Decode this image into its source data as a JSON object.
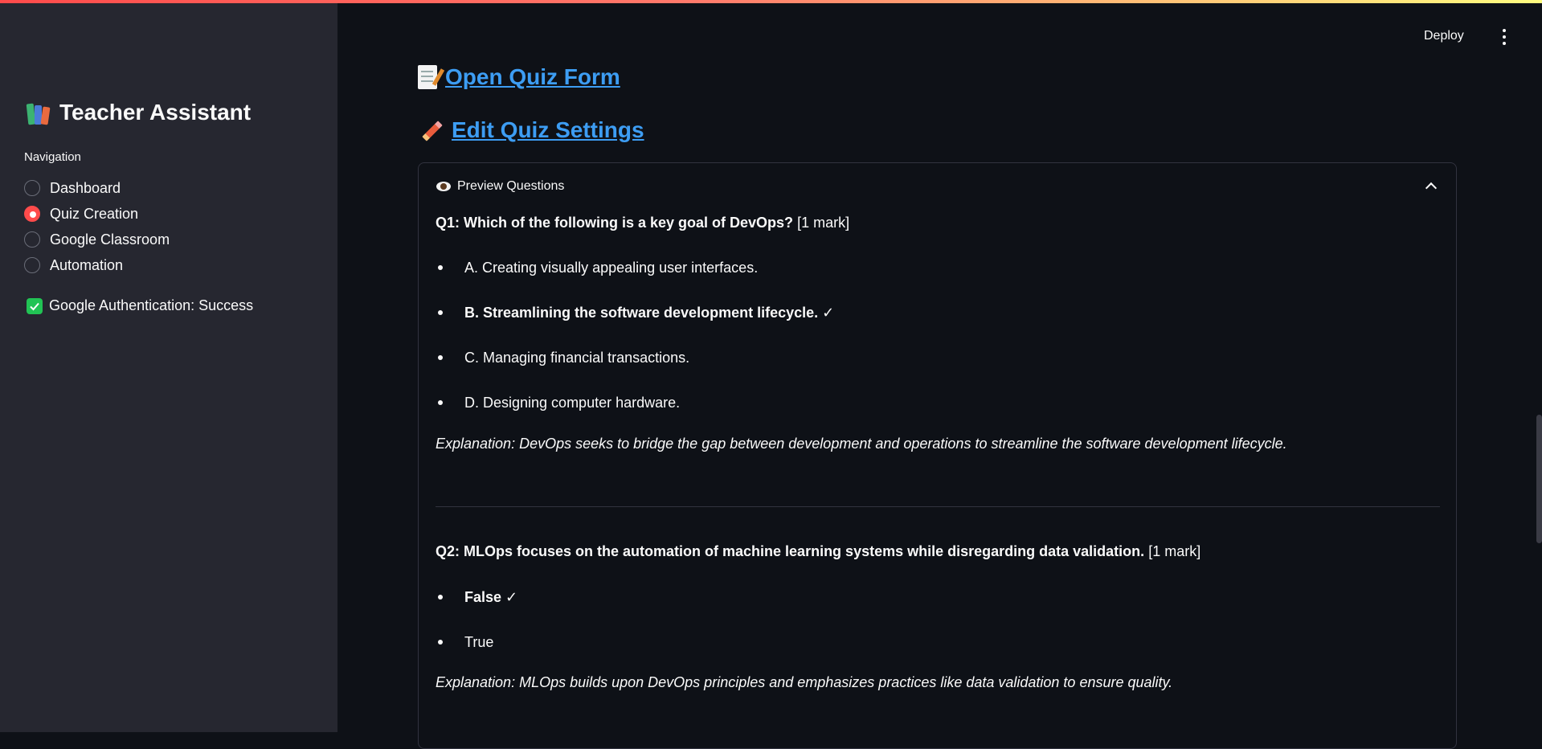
{
  "sidebar": {
    "title": "Teacher Assistant",
    "nav_label": "Navigation",
    "nav_items": [
      {
        "label": "Dashboard",
        "selected": false
      },
      {
        "label": "Quiz Creation",
        "selected": true
      },
      {
        "label": "Google Classroom",
        "selected": false
      },
      {
        "label": "Automation",
        "selected": false
      }
    ],
    "auth_status": "Google Authentication: Success"
  },
  "header": {
    "deploy_label": "Deploy"
  },
  "main": {
    "open_quiz_link": "Open Quiz Form",
    "edit_settings_link": "Edit Quiz Settings",
    "expander": {
      "title": "Preview Questions",
      "questions": [
        {
          "text": "Q1: Which of the following is a key goal of DevOps?",
          "marks": "[1 mark]",
          "options": [
            {
              "text": "A. Creating visually appealing user interfaces.",
              "correct": false
            },
            {
              "text": "B. Streamlining the software development lifecycle. ✓",
              "correct": true
            },
            {
              "text": "C. Managing financial transactions.",
              "correct": false
            },
            {
              "text": "D. Designing computer hardware.",
              "correct": false
            }
          ],
          "explanation": "Explanation: DevOps seeks to bridge the gap between development and operations to streamline the software development lifecycle."
        },
        {
          "text": "Q2: MLOps focuses on the automation of machine learning systems while disregarding data validation.",
          "marks": "[1 mark]",
          "options": [
            {
              "text": "False ✓",
              "correct": true
            },
            {
              "text": "True",
              "correct": false
            }
          ],
          "explanation": "Explanation: MLOps builds upon DevOps principles and emphasizes practices like data validation to ensure quality."
        }
      ]
    }
  },
  "colors": {
    "accent": "#ff4b4b",
    "link": "#3d9df3",
    "sidebar_bg": "#262730",
    "main_bg": "#0e1117",
    "success": "#21c354"
  }
}
